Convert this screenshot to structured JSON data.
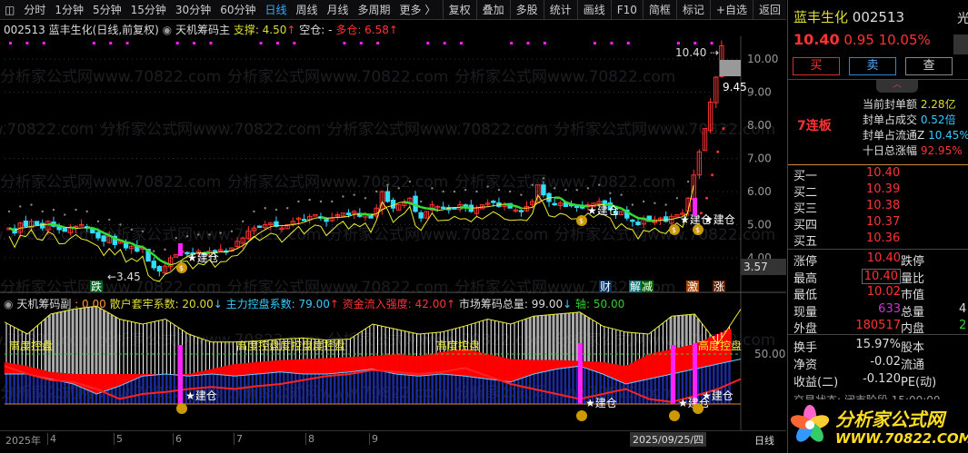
{
  "toolbar": {
    "tabs": [
      "分时",
      "1分钟",
      "5分钟",
      "15分钟",
      "30分钟",
      "60分钟",
      "日线",
      "周线",
      "月线",
      "多周期",
      "更多 〉"
    ],
    "active": "日线",
    "right": [
      "复权",
      "叠加",
      "多股",
      "统计",
      "画线",
      "F10",
      "简框",
      "标记",
      "+自选",
      "返回"
    ]
  },
  "info": {
    "code": "002513",
    "name_line": "蓝丰生化(日线,前复权)",
    "indicator": "天机筹码主",
    "support_label": "支撑: 4.50",
    "empty_label": "空仓: -",
    "long_label": "多仓: 6.58"
  },
  "sub_info": {
    "indicator": "天机筹码副",
    "v0": ": 0.00",
    "retail": "散户套牢系数: 20.00",
    "main": "主力控盘系数: 79.00",
    "inflow": "资金流入强度: 42.00",
    "total": "市场筹码总量: 99.00",
    "axis": "轴: 50.00"
  },
  "watermark": "分析家公式网www.70822.com",
  "chart_data": {
    "type": "candlestick",
    "y_ticks": [
      "10.00",
      "9.00",
      "8.00",
      "7.00",
      "6.00",
      "5.00",
      "4.00"
    ],
    "closes": [
      4.9,
      4.75,
      5.05,
      4.95,
      5.1,
      5.0,
      4.9,
      5.1,
      4.95,
      4.85,
      4.8,
      4.9,
      4.95,
      5.0,
      4.9,
      4.75,
      4.6,
      4.5,
      4.65,
      4.4,
      4.5,
      4.3,
      4.35,
      4.2,
      4.3,
      3.9,
      3.7,
      3.6,
      3.75,
      4.0,
      4.1,
      4.2,
      4.15,
      4.1,
      4.2,
      4.1,
      4.2,
      4.15,
      4.25,
      4.2,
      4.3,
      4.5,
      4.6,
      4.8,
      4.9,
      4.95,
      5.0,
      5.05,
      4.95,
      4.9,
      5.0,
      5.1,
      5.2,
      5.15,
      5.25,
      5.3,
      5.2,
      5.1,
      5.2,
      5.3,
      5.35,
      5.3,
      5.4,
      5.25,
      5.3,
      5.2,
      5.5,
      6.0,
      5.7,
      5.5,
      5.6,
      5.65,
      5.8,
      5.4,
      5.2,
      5.4,
      5.6,
      5.55,
      5.5,
      5.45,
      5.5,
      5.6,
      5.55,
      5.4,
      5.5,
      5.6,
      5.65,
      5.7,
      5.55,
      5.6,
      5.5,
      5.45,
      5.4,
      5.55,
      5.7,
      6.2,
      5.9,
      5.7,
      5.6,
      5.65,
      5.55,
      5.6,
      5.55,
      5.5,
      5.6,
      5.65,
      5.7,
      5.6,
      5.45,
      5.3,
      5.4,
      5.2,
      5.1,
      5.0,
      5.2,
      5.1,
      5.15,
      5.2,
      5.1,
      5.25,
      5.3,
      5.35,
      5.8,
      6.5,
      7.2,
      7.9,
      8.7,
      9.45,
      10.4
    ],
    "low_label": "3.45",
    "high_label": "10.40",
    "last_box": "9.45",
    "cursor_price": "3.57",
    "signals": [
      "建仓",
      "建仓",
      "建仓"
    ],
    "bottom_tags": [
      "跌",
      "财",
      "解",
      "减",
      "激",
      "涨"
    ],
    "sub_axis_tick": "50.00",
    "sub_labels": [
      "高度控盘",
      "高度控盘度控盘度控盘",
      "高度控盘",
      "高度控盘"
    ],
    "sub_series": {
      "total": [
        82,
        70,
        90,
        95,
        98,
        85,
        80,
        85,
        70,
        62,
        62,
        63,
        65,
        66,
        64,
        65,
        80,
        75,
        70,
        72,
        78,
        85,
        80,
        88,
        90,
        92,
        78,
        72,
        70,
        88,
        90,
        60,
        95
      ],
      "main": [
        30,
        30,
        25,
        20,
        10,
        18,
        28,
        30,
        28,
        30,
        28,
        30,
        32,
        30,
        30,
        32,
        35,
        30,
        28,
        30,
        28,
        25,
        22,
        30,
        35,
        38,
        30,
        20,
        25,
        30,
        35,
        40,
        45
      ],
      "red_top": [
        42,
        38,
        32,
        30,
        30,
        30,
        30,
        30,
        30,
        35,
        40,
        42,
        44,
        45,
        46,
        47,
        48,
        50,
        48,
        52,
        55,
        50,
        45,
        44,
        44,
        43,
        42,
        38,
        50,
        55,
        60,
        70,
        80
      ],
      "retail": [
        18,
        10,
        4,
        2,
        -5,
        -15,
        -10,
        -8,
        -5,
        -3,
        -5,
        -2,
        0,
        4,
        8,
        10,
        14,
        12,
        10,
        12,
        16,
        8,
        0,
        -5,
        -10,
        -15,
        -10,
        -5,
        -15,
        -18,
        -12,
        -5,
        5
      ]
    }
  },
  "date_axis": {
    "labels": [
      "2025年",
      "4",
      "5",
      "6",
      "7",
      "8",
      "9"
    ],
    "current": "2025/09/25/四",
    "period": "日线"
  },
  "panel": {
    "name": "蓝丰生化",
    "code": "002513",
    "price": "10.40",
    "change": "0.95",
    "pct": "10.05%",
    "clipped": "光",
    "buy": "买",
    "sell": "卖",
    "check": "查",
    "limit_streak": "7连板",
    "seal": [
      {
        "k": "当前封单额",
        "v": "2.28亿"
      },
      {
        "k": "封单占成交",
        "v": "0.52倍"
      },
      {
        "k": "封单占流通Z",
        "v": "10.45%"
      },
      {
        "k": "十日总涨幅",
        "v": "92.95%"
      }
    ],
    "bids": [
      {
        "k": "买一",
        "v": "10.40"
      },
      {
        "k": "买二",
        "v": "10.39"
      },
      {
        "k": "买三",
        "v": "10.38"
      },
      {
        "k": "买四",
        "v": "10.37"
      },
      {
        "k": "买五",
        "v": "10.36"
      }
    ],
    "stats": [
      {
        "k": "涨停",
        "v": "10.40",
        "k2": "跌停",
        "v2": ""
      },
      {
        "k": "最高",
        "v": "10.40",
        "k2": "量比",
        "v2": ""
      },
      {
        "k": "最低",
        "v": "10.02",
        "k2": "市值",
        "v2": ""
      },
      {
        "k": "现量",
        "v": "633",
        "k2": "总量",
        "v2": "4"
      },
      {
        "k": "外盘",
        "v": "180517",
        "k2": "内盘",
        "v2": "2"
      }
    ],
    "stats2": [
      {
        "k": "换手",
        "v": "15.97%",
        "k2": "股本"
      },
      {
        "k": "净资",
        "v": "-0.02",
        "k2": "流通"
      },
      {
        "k": "收益(二)",
        "v": "-0.120",
        "k2": "PE(动)"
      }
    ],
    "status": "交易状态: 闭市阶段 15:00:00",
    "logo_text": "分析家公式网",
    "logo_url": "WWW.70822.COM"
  },
  "colors": {
    "up": "#ff3333",
    "down": "#33ddff",
    "ma": "#33dd33",
    "yellow": "#eeee33",
    "magenta": "#ff22ff"
  }
}
